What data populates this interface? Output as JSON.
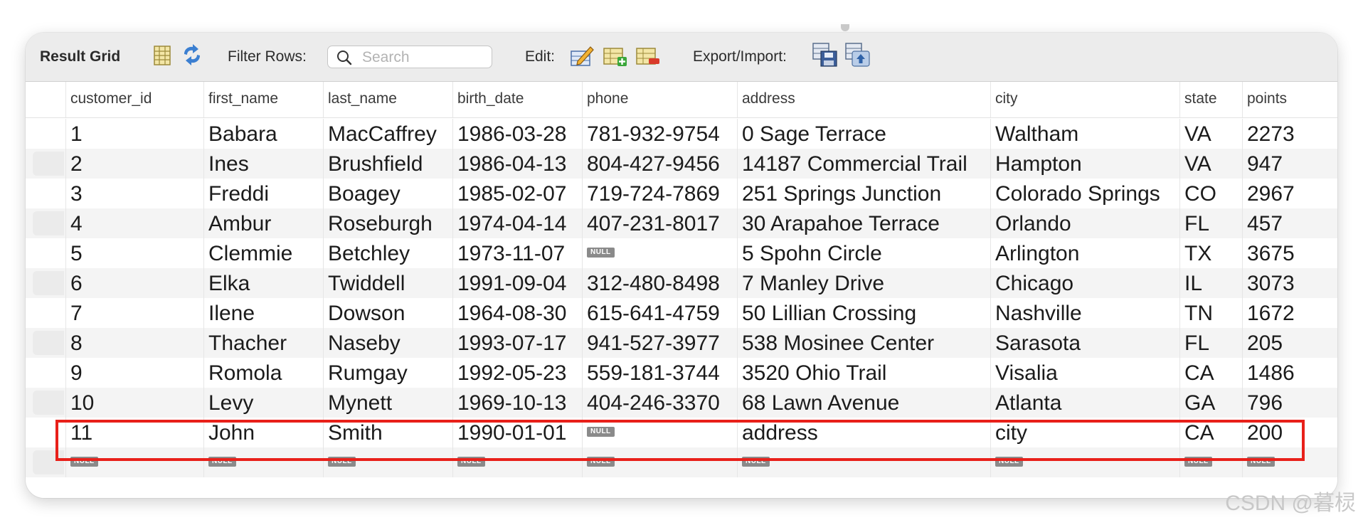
{
  "toolbar": {
    "title": "Result Grid",
    "filter_label": "Filter Rows:",
    "search_placeholder": "Search",
    "edit_label": "Edit:",
    "export_label": "Export/Import:"
  },
  "columns": [
    "customer_id",
    "first_name",
    "last_name",
    "birth_date",
    "phone",
    "address",
    "city",
    "state",
    "points"
  ],
  "rows": [
    [
      "1",
      "Babara",
      "MacCaffrey",
      "1986-03-28",
      "781-932-9754",
      "0 Sage Terrace",
      "Waltham",
      "VA",
      "2273"
    ],
    [
      "2",
      "Ines",
      "Brushfield",
      "1986-04-13",
      "804-427-9456",
      "14187 Commercial Trail",
      "Hampton",
      "VA",
      "947"
    ],
    [
      "3",
      "Freddi",
      "Boagey",
      "1985-02-07",
      "719-724-7869",
      "251 Springs Junction",
      "Colorado Springs",
      "CO",
      "2967"
    ],
    [
      "4",
      "Ambur",
      "Roseburgh",
      "1974-04-14",
      "407-231-8017",
      "30 Arapahoe Terrace",
      "Orlando",
      "FL",
      "457"
    ],
    [
      "5",
      "Clemmie",
      "Betchley",
      "1973-11-07",
      null,
      "5 Spohn Circle",
      "Arlington",
      "TX",
      "3675"
    ],
    [
      "6",
      "Elka",
      "Twiddell",
      "1991-09-04",
      "312-480-8498",
      "7 Manley Drive",
      "Chicago",
      "IL",
      "3073"
    ],
    [
      "7",
      "Ilene",
      "Dowson",
      "1964-08-30",
      "615-641-4759",
      "50 Lillian Crossing",
      "Nashville",
      "TN",
      "1672"
    ],
    [
      "8",
      "Thacher",
      "Naseby",
      "1993-07-17",
      "941-527-3977",
      "538 Mosinee Center",
      "Sarasota",
      "FL",
      "205"
    ],
    [
      "9",
      "Romola",
      "Rumgay",
      "1992-05-23",
      "559-181-3744",
      "3520 Ohio Trail",
      "Visalia",
      "CA",
      "1486"
    ],
    [
      "10",
      "Levy",
      "Mynett",
      "1969-10-13",
      "404-246-3370",
      "68 Lawn Avenue",
      "Atlanta",
      "GA",
      "796"
    ],
    [
      "11",
      "John",
      "Smith",
      "1990-01-01",
      null,
      "address",
      "city",
      "CA",
      "200"
    ],
    [
      null,
      null,
      null,
      null,
      null,
      null,
      null,
      null,
      null
    ]
  ],
  "null_label": "NULL",
  "highlighted_row": 11,
  "watermark": "CSDN @暮棂",
  "colors": {
    "highlight": "#e8201a",
    "toolbar_bg": "#ececec",
    "alt_row": "#f4f4f4"
  }
}
